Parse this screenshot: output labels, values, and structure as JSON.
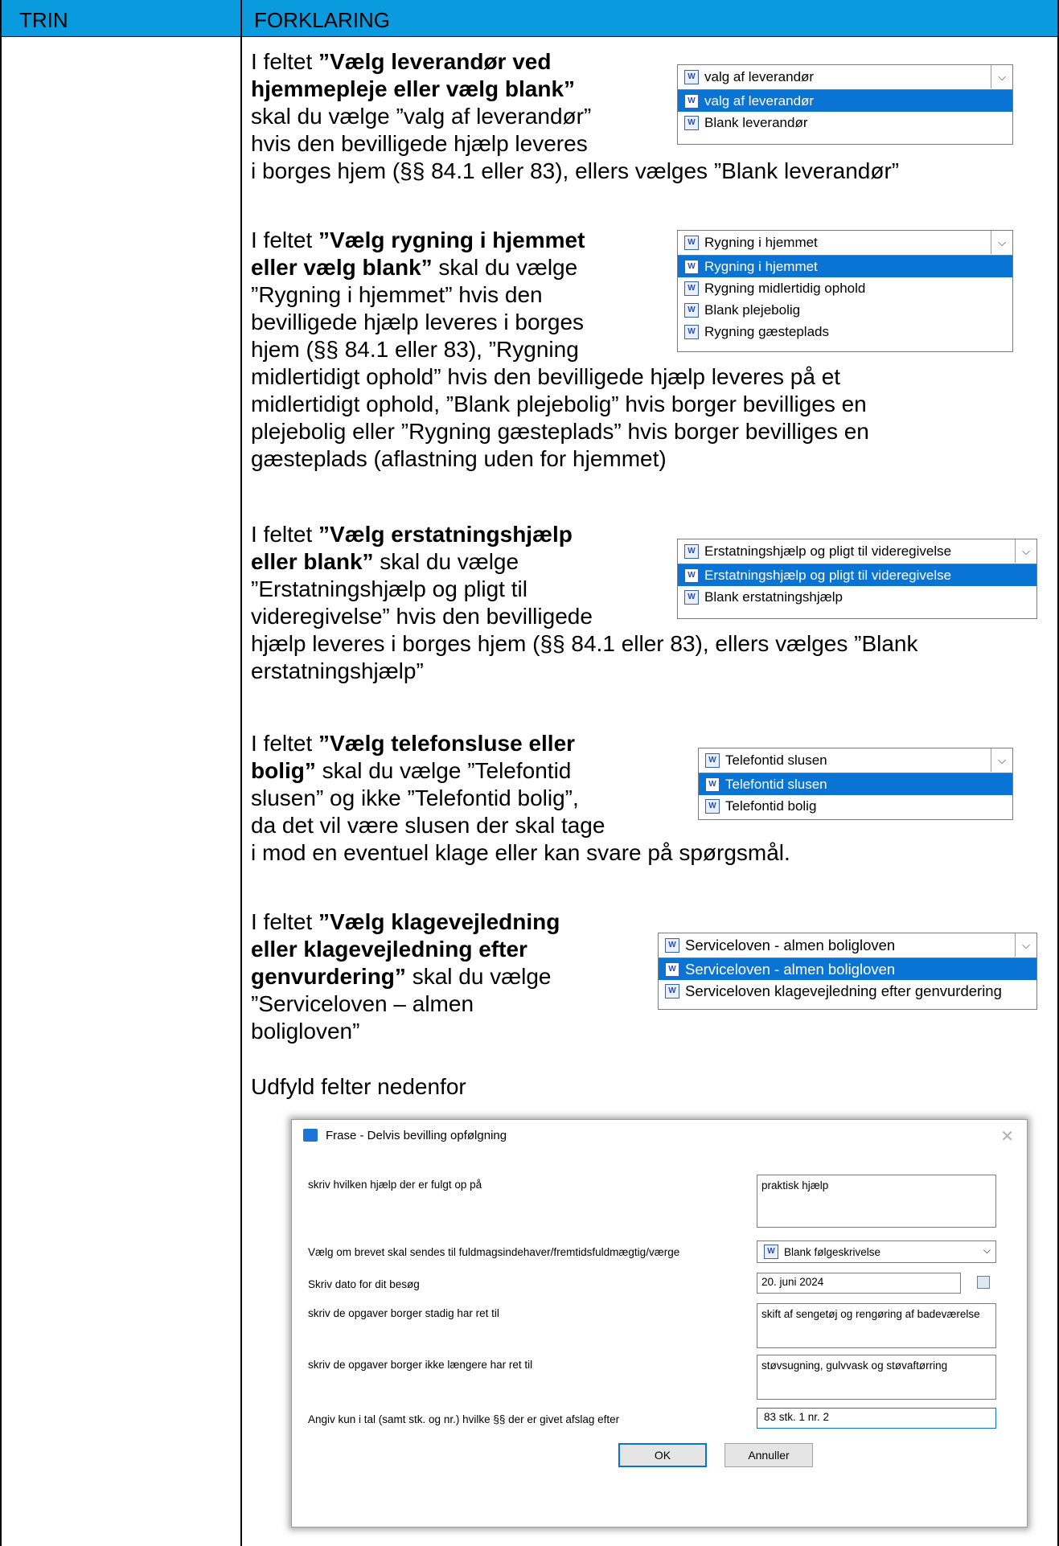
{
  "header": {
    "col1": "TRIN",
    "col2": "FORKLARING"
  },
  "p1": {
    "pre": "I feltet ",
    "bold": "”Vælg leverandør ved hjemmepleje eller vælg blank”",
    "line1": "I feltet ",
    "b1": "”Vælg leverandør ved",
    "b2": "hjemmepleje eller vælg blank”",
    "l3": "skal du vælge ”valg af leverandør”",
    "l4": "hvis den bevilligede hjælp leveres",
    "l5": "i borges hjem (§§ 84.1 eller 83), ellers vælges ”Blank leverandør”"
  },
  "dd1": {
    "selected": "valg af leverandør",
    "options": [
      "valg af leverandør",
      "Blank leverandør"
    ]
  },
  "p2": {
    "l1pre": "I feltet ",
    "l1b": "”Vælg rygning i hjemmet",
    "l2b": "eller vælg blank”",
    "l2": " skal du vælge",
    "l3": "”Rygning i hjemmet” hvis den",
    "l4": "bevilligede hjælp leveres i borges",
    "l5": "hjem (§§ 84.1 eller 83), ”Rygning",
    "l6": "midlertidigt ophold” hvis den bevilligede hjælp leveres på et",
    "l7": "midlertidigt ophold, ”Blank plejebolig” hvis borger bevilliges en",
    "l8": "plejebolig eller ”Rygning gæsteplads” hvis borger bevilliges en",
    "l9": "gæsteplads (aflastning uden for hjemmet)"
  },
  "dd2": {
    "selected": "Rygning i hjemmet",
    "options": [
      "Rygning i hjemmet",
      "Rygning midlertidig ophold",
      "Blank plejebolig",
      "Rygning gæsteplads"
    ]
  },
  "p3": {
    "l1pre": "I feltet ",
    "l1b": "”Vælg erstatningshjælp",
    "l2b": "eller blank”",
    "l2": " skal du vælge",
    "l3": "”Erstatningshjælp og pligt til",
    "l4": "videregivelse” hvis den bevilligede",
    "l5": "hjælp leveres i borges hjem (§§ 84.1 eller 83), ellers vælges ”Blank",
    "l6": "erstatningshjælp”"
  },
  "dd3": {
    "selected": "Erstatningshjælp og pligt til videregivelse",
    "options": [
      "Erstatningshjælp og pligt til videregivelse",
      "Blank erstatningshjælp"
    ]
  },
  "p4": {
    "l1pre": "I feltet ",
    "l1b": "”Vælg telefonsluse eller",
    "l2b": "bolig”",
    "l2": " skal du vælge ”Telefontid",
    "l3": "slusen” og ikke ”Telefontid bolig”,",
    "l4": "da det vil være slusen der skal tage",
    "l5": "i mod en eventuel klage eller kan svare på spørgsmål."
  },
  "dd4": {
    "selected": "Telefontid slusen",
    "options": [
      "Telefontid slusen",
      "Telefontid bolig"
    ]
  },
  "p5": {
    "l1pre": "I feltet ",
    "l1b": "”Vælg klagevejledning",
    "l2b": "eller klagevejledning efter",
    "l3b": "genvurdering”",
    "l3": " skal du vælge",
    "l4": "”Serviceloven – almen",
    "l5": "boligloven”"
  },
  "dd5": {
    "selected": "Serviceloven - almen boligloven",
    "options": [
      "Serviceloven - almen boligloven",
      "Serviceloven klagevejledning efter genvurdering"
    ]
  },
  "p6": {
    "text": "Udfyld felter nedenfor"
  },
  "dialog": {
    "title": "Frase - Delvis bevilling opfølgning",
    "close": "✕",
    "fields": [
      {
        "label": "skriv hvilken hjælp der er fulgt op på",
        "value": "praktisk hjælp"
      },
      {
        "label": "Vælg om brevet skal sendes til fuldmagsindehaver/fremtidsfuldmægtig/værge",
        "value": "Blank følgeskrivelse"
      },
      {
        "label": "Skriv dato for dit besøg",
        "value": "20. juni 2024"
      },
      {
        "label": "skriv de opgaver borger stadig har ret til",
        "value": "skift af sengetøj og rengøring af badeværelse"
      },
      {
        "label": "skriv de opgaver borger ikke længere har ret til",
        "value": "støvsugning, gulvvask og støvaftørring"
      },
      {
        "label": "Angiv kun i tal (samt stk. og nr.) hvilke §§ der er givet afslag efter",
        "value": "83 stk. 1 nr. 2"
      }
    ],
    "ok": "OK",
    "cancel": "Annuller"
  },
  "icons": {
    "word": "W",
    "chevron": "⌵"
  }
}
